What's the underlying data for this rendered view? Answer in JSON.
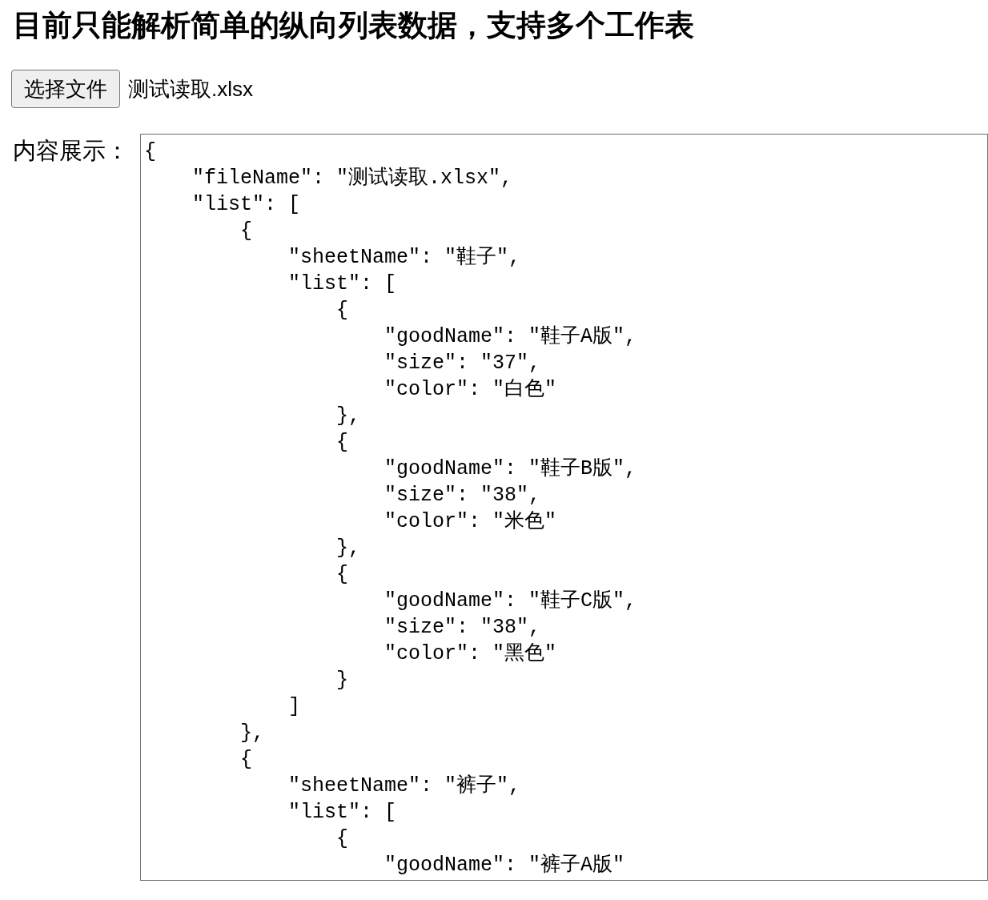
{
  "heading": "目前只能解析简单的纵向列表数据，支持多个工作表",
  "file_picker": {
    "button": "选择文件",
    "file_name": "测试读取.xlsx"
  },
  "content": {
    "label": "内容展示：",
    "value": "{\n    \"fileName\": \"测试读取.xlsx\",\n    \"list\": [\n        {\n            \"sheetName\": \"鞋子\",\n            \"list\": [\n                {\n                    \"goodName\": \"鞋子A版\",\n                    \"size\": \"37\",\n                    \"color\": \"白色\"\n                },\n                {\n                    \"goodName\": \"鞋子B版\",\n                    \"size\": \"38\",\n                    \"color\": \"米色\"\n                },\n                {\n                    \"goodName\": \"鞋子C版\",\n                    \"size\": \"38\",\n                    \"color\": \"黑色\"\n                }\n            ]\n        },\n        {\n            \"sheetName\": \"裤子\",\n            \"list\": [\n                {\n                    \"goodName\": \"裤子A版\""
  }
}
